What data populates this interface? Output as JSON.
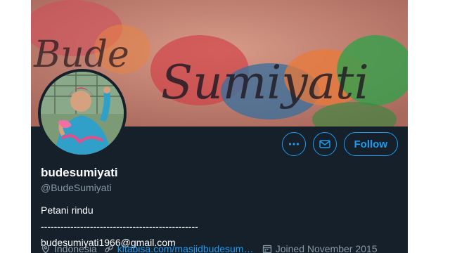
{
  "profile": {
    "display_name": "budesumiyati",
    "handle": "@BudeSumiyati",
    "bio_line1": "Petani rindu",
    "bio_line2": "------------------------------------------------",
    "bio_line3": "budesumiyati1966@gmail.com",
    "banner_text_1": "Bude",
    "banner_text_2": "Sumiyati"
  },
  "actions": {
    "more_icon": "more-icon",
    "message_icon": "envelope-icon",
    "follow_label": "Follow"
  },
  "meta": {
    "location": "Indonesia",
    "website": "kitabisa.com/masjidbudesumi…",
    "joined": "Joined November 2015"
  },
  "colors": {
    "background": "#15202b",
    "accent": "#1d9bf0",
    "muted": "#8899a6"
  }
}
